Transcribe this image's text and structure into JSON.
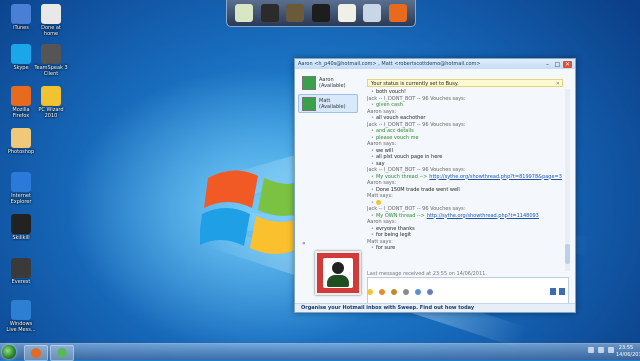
{
  "desktop": {
    "icons": [
      {
        "label": "iTunes",
        "color": "#4a7fd6"
      },
      {
        "label": "Done at\nhome",
        "color": "#e8e8e8"
      },
      {
        "label": "Skype",
        "color": "#1aa6e8"
      },
      {
        "label": "TeamSpeak 3\nClient",
        "color": "#555555"
      },
      {
        "label": "Mozilla\nFirefox",
        "color": "#e86a1e"
      },
      {
        "label": "PC Wizard\n2010",
        "color": "#f1c232"
      },
      {
        "label": "Photoshop",
        "color": "#f0c87a"
      },
      {
        "label": "Internet\nExplorer",
        "color": "#2b79d8"
      },
      {
        "label": "Skillkill",
        "color": "#222222"
      },
      {
        "label": "Everest",
        "color": "#3a3a3a"
      },
      {
        "label": "Windows\nLive Mess...",
        "color": "#2d7fd3"
      }
    ]
  },
  "dock": {
    "items": [
      {
        "name": "documents",
        "color": "#d8e7c3"
      },
      {
        "name": "headphones",
        "color": "#2b2b2b"
      },
      {
        "name": "film-reel",
        "color": "#6b5a3a"
      },
      {
        "name": "briefcase",
        "color": "#1d1d1d"
      },
      {
        "name": "notepad",
        "color": "#f0f0e8"
      },
      {
        "name": "recycle-bin",
        "color": "#c9d6e6"
      },
      {
        "name": "firefox",
        "color": "#e86a1e"
      }
    ]
  },
  "chat": {
    "title": "Aaron <h_p40s@hotmail.com> , Matt <robertscottdemo@hotmail.com>",
    "contacts": [
      {
        "name": "Aaron",
        "status": "(Available)"
      },
      {
        "name": "Matt",
        "status": "(Available)"
      }
    ],
    "notice": "Your status is currently set to Busy.",
    "messages": [
      {
        "type": "msg",
        "text": "both vouch!"
      },
      {
        "type": "sender",
        "text": "Jack -- I_DONT_BOT -- 96 Vouches says:"
      },
      {
        "type": "green",
        "text": "given cash"
      },
      {
        "type": "sender",
        "text": "Aaron says:"
      },
      {
        "type": "msg",
        "text": "all vouch eachother"
      },
      {
        "type": "sender",
        "text": "Jack -- I_DONT_BOT -- 96 Vouches says:"
      },
      {
        "type": "green",
        "text": "and acc details"
      },
      {
        "type": "green",
        "text": "please vouch me"
      },
      {
        "type": "sender",
        "text": "Aaron says:"
      },
      {
        "type": "msg",
        "text": "we will"
      },
      {
        "type": "msg",
        "text": "all plst vouch page in here"
      },
      {
        "type": "msg",
        "text": "say"
      },
      {
        "type": "sender",
        "text": "Jack -- I_DONT_BOT -- 96 Vouches says:"
      },
      {
        "type": "link",
        "text": "My vouch thread -->",
        "link": "http://sythe.org/showthread.php?t=819978&page=3"
      },
      {
        "type": "sender",
        "text": "Aaron says:"
      },
      {
        "type": "msg",
        "text": "Done 150M trade trade went well"
      },
      {
        "type": "sender",
        "text": "Matt says:"
      },
      {
        "type": "smile",
        "text": ""
      },
      {
        "type": "sender",
        "text": "Jack -- I_DONT_BOT -- 96 Vouches says:"
      },
      {
        "type": "link",
        "text": "My OWN thread -->",
        "link": "http://sythe.org/showthread.php?t=1148093"
      },
      {
        "type": "sender",
        "text": "Aaron says:"
      },
      {
        "type": "msg",
        "text": "evryone thanks"
      },
      {
        "type": "msg",
        "text": "for being legit"
      },
      {
        "type": "sender",
        "text": "Matt says:"
      },
      {
        "type": "msg",
        "text": "for sure"
      }
    ],
    "last_message": "Last message received at 23:55 on 14/06/2011.",
    "footer": "Organise your Hotmail inbox with Sweep. Find out how today"
  },
  "taskbar": {
    "apps": [
      {
        "name": "firefox",
        "color": "#e86a1e"
      },
      {
        "name": "msn",
        "color": "#5bb75b"
      }
    ],
    "clock_time": "23:55",
    "clock_date": "14/06/2011"
  }
}
